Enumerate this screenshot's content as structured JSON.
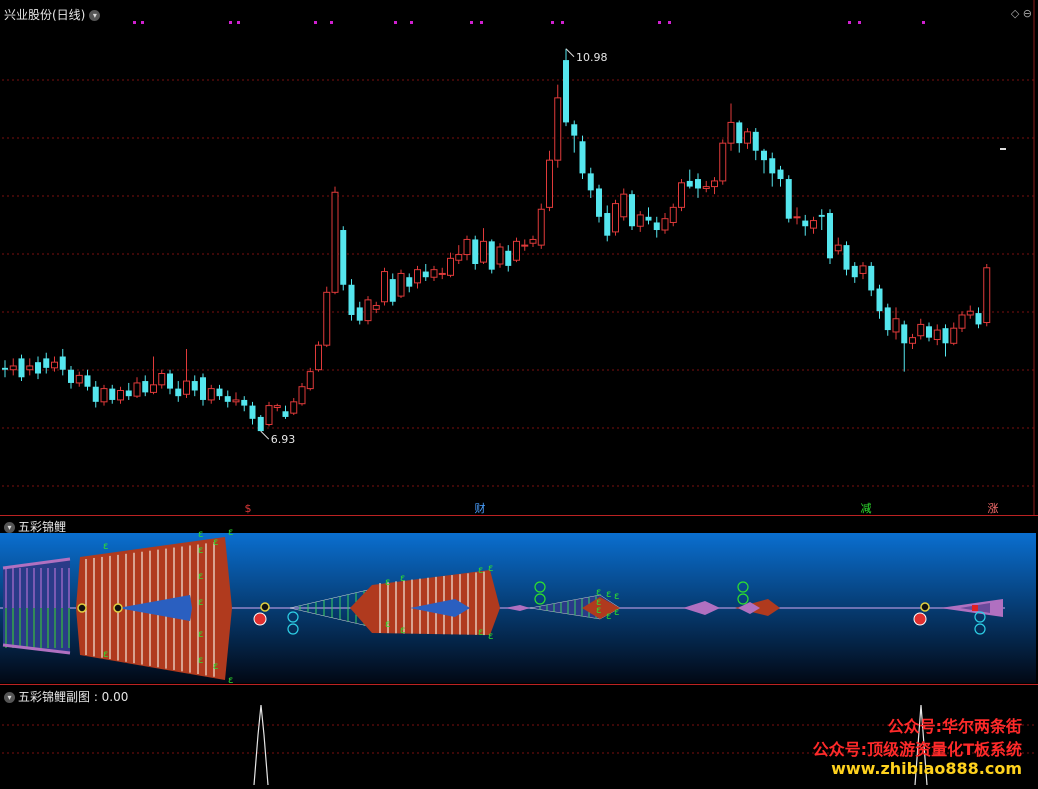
{
  "main_panel": {
    "title": "兴业股份(日线)",
    "high_label": "10.98",
    "low_label": "6.93",
    "markers": [
      "$",
      "财",
      "减",
      "涨"
    ],
    "colors": {
      "up": "#e03a3a",
      "down": "#55e6ee",
      "grid": "#7a1010",
      "marker_dots": "#d020d0"
    }
  },
  "sub_panel_1": {
    "title": "五彩锦鲤",
    "colors": {
      "band": "#b03a1e",
      "green_mark": "#2ee02e",
      "cyan_mark": "#2ed0e6",
      "purple": "#b070c0"
    }
  },
  "sub_panel_2": {
    "title": "五彩锦鲤副图 : 0.00",
    "watermark_lines": [
      "公众号:华尔两条街",
      "公众号:顶级游资量化T板系统",
      "www.zhibiao888.com"
    ],
    "watermark_colors": [
      "#ff2a2a",
      "#ff2a2a",
      "#ffd21e"
    ]
  },
  "chart_data": {
    "type": "candlestick",
    "title": "兴业股份(日线)",
    "annotations": [
      {
        "label": "10.98",
        "type": "high"
      },
      {
        "label": "6.93",
        "type": "low"
      }
    ],
    "ylim": [
      6.2,
      11.2
    ],
    "candles": [
      [
        7.6,
        7.58,
        7.68,
        7.5
      ],
      [
        7.58,
        7.62,
        7.7,
        7.52
      ],
      [
        7.7,
        7.5,
        7.74,
        7.46
      ],
      [
        7.58,
        7.62,
        7.7,
        7.52
      ],
      [
        7.66,
        7.54,
        7.72,
        7.48
      ],
      [
        7.7,
        7.6,
        7.76,
        7.54
      ],
      [
        7.6,
        7.66,
        7.72,
        7.56
      ],
      [
        7.72,
        7.58,
        7.8,
        7.52
      ],
      [
        7.58,
        7.44,
        7.62,
        7.38
      ],
      [
        7.44,
        7.52,
        7.56,
        7.4
      ],
      [
        7.52,
        7.4,
        7.58,
        7.36
      ],
      [
        7.4,
        7.24,
        7.46,
        7.18
      ],
      [
        7.24,
        7.38,
        7.42,
        7.2
      ],
      [
        7.38,
        7.26,
        7.42,
        7.22
      ],
      [
        7.26,
        7.36,
        7.4,
        7.22
      ],
      [
        7.36,
        7.3,
        7.44,
        7.26
      ],
      [
        7.3,
        7.44,
        7.5,
        7.28
      ],
      [
        7.46,
        7.34,
        7.52,
        7.3
      ],
      [
        7.34,
        7.42,
        7.72,
        7.32
      ],
      [
        7.42,
        7.54,
        7.58,
        7.38
      ],
      [
        7.54,
        7.38,
        7.58,
        7.32
      ],
      [
        7.38,
        7.3,
        7.46,
        7.24
      ],
      [
        7.32,
        7.46,
        7.8,
        7.28
      ],
      [
        7.46,
        7.36,
        7.52,
        7.3
      ],
      [
        7.5,
        7.26,
        7.54,
        7.2
      ],
      [
        7.26,
        7.38,
        7.42,
        7.22
      ],
      [
        7.38,
        7.3,
        7.42,
        7.26
      ],
      [
        7.3,
        7.24,
        7.36,
        7.18
      ],
      [
        7.24,
        7.26,
        7.34,
        7.2
      ],
      [
        7.26,
        7.2,
        7.3,
        7.14
      ],
      [
        7.2,
        7.06,
        7.24,
        7.0
      ],
      [
        7.08,
        6.93,
        7.1,
        6.93
      ],
      [
        7.0,
        7.2,
        7.24,
        6.98
      ],
      [
        7.18,
        7.2,
        7.22,
        7.14
      ],
      [
        7.14,
        7.08,
        7.2,
        7.06
      ],
      [
        7.12,
        7.24,
        7.28,
        7.1
      ],
      [
        7.22,
        7.4,
        7.44,
        7.2
      ],
      [
        7.38,
        7.56,
        7.6,
        7.36
      ],
      [
        7.58,
        7.84,
        7.88,
        7.56
      ],
      [
        7.84,
        8.4,
        8.46,
        7.82
      ],
      [
        8.4,
        9.46,
        9.52,
        8.38
      ],
      [
        9.06,
        8.48,
        9.1,
        8.42
      ],
      [
        8.48,
        8.16,
        8.54,
        8.1
      ],
      [
        8.24,
        8.1,
        8.3,
        8.06
      ],
      [
        8.1,
        8.32,
        8.36,
        8.06
      ],
      [
        8.22,
        8.26,
        8.3,
        8.18
      ],
      [
        8.3,
        8.62,
        8.66,
        8.26
      ],
      [
        8.54,
        8.3,
        8.6,
        8.26
      ],
      [
        8.36,
        8.6,
        8.64,
        8.34
      ],
      [
        8.56,
        8.46,
        8.6,
        8.4
      ],
      [
        8.5,
        8.64,
        8.68,
        8.44
      ],
      [
        8.62,
        8.56,
        8.7,
        8.52
      ],
      [
        8.56,
        8.64,
        8.68,
        8.52
      ],
      [
        8.6,
        8.6,
        8.66,
        8.54
      ],
      [
        8.58,
        8.76,
        8.82,
        8.56
      ],
      [
        8.74,
        8.8,
        8.9,
        8.7
      ],
      [
        8.8,
        8.96,
        9.0,
        8.74
      ],
      [
        8.96,
        8.7,
        9.0,
        8.64
      ],
      [
        8.72,
        8.94,
        9.08,
        8.7
      ],
      [
        8.94,
        8.64,
        8.96,
        8.6
      ],
      [
        8.7,
        8.88,
        8.92,
        8.66
      ],
      [
        8.84,
        8.68,
        8.9,
        8.62
      ],
      [
        8.74,
        8.94,
        8.98,
        8.72
      ],
      [
        8.9,
        8.9,
        8.96,
        8.84
      ],
      [
        8.92,
        8.96,
        9.0,
        8.88
      ],
      [
        8.9,
        9.28,
        9.34,
        8.86
      ],
      [
        9.3,
        9.8,
        9.9,
        9.26
      ],
      [
        9.8,
        10.46,
        10.6,
        9.72
      ],
      [
        10.86,
        10.2,
        10.98,
        10.16
      ],
      [
        10.18,
        10.06,
        10.22,
        9.88
      ],
      [
        10.0,
        9.66,
        10.06,
        9.6
      ],
      [
        9.66,
        9.48,
        9.72,
        9.4
      ],
      [
        9.5,
        9.2,
        9.54,
        9.14
      ],
      [
        9.24,
        9.0,
        9.32,
        8.94
      ],
      [
        9.04,
        9.34,
        9.38,
        9.0
      ],
      [
        9.2,
        9.44,
        9.5,
        9.16
      ],
      [
        9.44,
        9.1,
        9.48,
        9.06
      ],
      [
        9.1,
        9.22,
        9.26,
        9.04
      ],
      [
        9.2,
        9.16,
        9.3,
        9.12
      ],
      [
        9.14,
        9.06,
        9.2,
        8.98
      ],
      [
        9.06,
        9.18,
        9.24,
        9.02
      ],
      [
        9.14,
        9.3,
        9.34,
        9.1
      ],
      [
        9.3,
        9.56,
        9.6,
        9.26
      ],
      [
        9.58,
        9.52,
        9.7,
        9.5
      ],
      [
        9.6,
        9.5,
        9.66,
        9.4
      ],
      [
        9.5,
        9.52,
        9.58,
        9.46
      ],
      [
        9.52,
        9.58,
        9.62,
        9.44
      ],
      [
        9.58,
        9.98,
        10.02,
        9.54
      ],
      [
        9.98,
        10.2,
        10.4,
        9.9
      ],
      [
        10.2,
        9.98,
        10.22,
        9.88
      ],
      [
        9.98,
        10.1,
        10.14,
        9.92
      ],
      [
        10.1,
        9.9,
        10.14,
        9.8
      ],
      [
        9.9,
        9.8,
        9.92,
        9.66
      ],
      [
        9.82,
        9.66,
        9.88,
        9.52
      ],
      [
        9.7,
        9.6,
        9.74,
        9.52
      ],
      [
        9.6,
        9.18,
        9.64,
        9.14
      ],
      [
        9.2,
        9.2,
        9.3,
        9.12
      ],
      [
        9.16,
        9.1,
        9.22,
        9.0
      ],
      [
        9.08,
        9.16,
        9.2,
        9.02
      ],
      [
        9.22,
        9.2,
        9.28,
        9.06
      ],
      [
        9.24,
        8.76,
        9.28,
        8.7
      ],
      [
        8.84,
        8.9,
        8.98,
        8.8
      ],
      [
        8.9,
        8.64,
        8.94,
        8.58
      ],
      [
        8.68,
        8.56,
        8.72,
        8.5
      ],
      [
        8.6,
        8.68,
        8.72,
        8.54
      ],
      [
        8.68,
        8.42,
        8.72,
        8.36
      ],
      [
        8.44,
        8.2,
        8.48,
        8.12
      ],
      [
        8.24,
        8.0,
        8.28,
        7.94
      ],
      [
        7.98,
        8.12,
        8.24,
        7.9
      ],
      [
        8.06,
        7.86,
        8.1,
        7.56
      ],
      [
        7.86,
        7.92,
        7.96,
        7.8
      ],
      [
        7.94,
        8.06,
        8.12,
        7.9
      ],
      [
        8.04,
        7.92,
        8.08,
        7.88
      ],
      [
        7.9,
        8.0,
        8.06,
        7.84
      ],
      [
        8.02,
        7.86,
        8.06,
        7.72
      ],
      [
        7.86,
        8.02,
        8.08,
        7.84
      ],
      [
        8.02,
        8.16,
        8.2,
        7.98
      ],
      [
        8.16,
        8.2,
        8.26,
        8.12
      ],
      [
        8.18,
        8.06,
        8.24,
        8.02
      ],
      [
        8.08,
        8.66,
        8.7,
        8.04
      ]
    ]
  }
}
